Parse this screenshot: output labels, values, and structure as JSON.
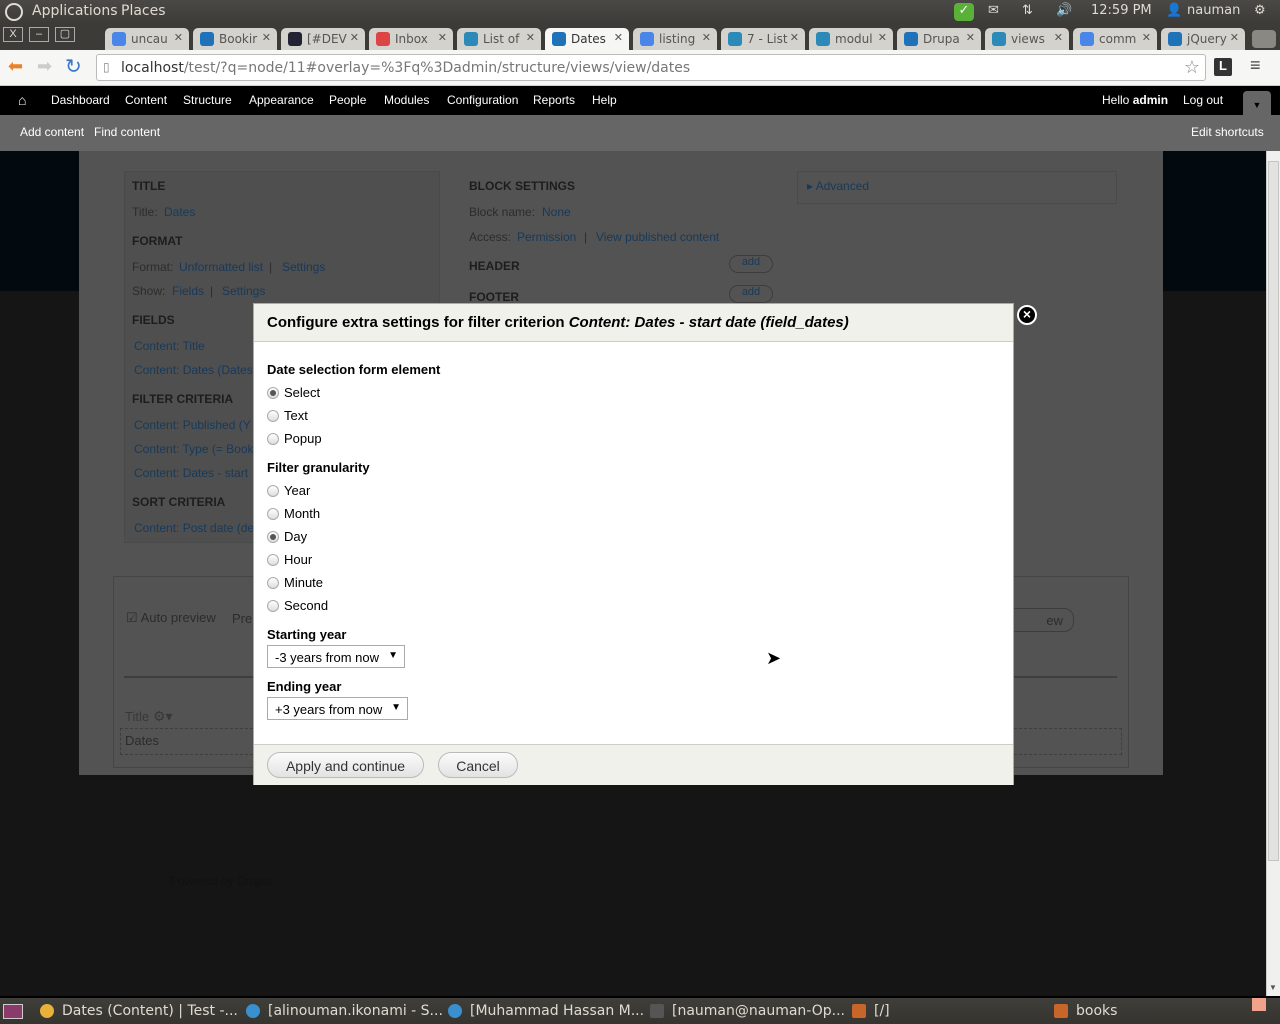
{
  "os_panel": {
    "menus": [
      "Applications",
      "Places"
    ],
    "time": "12:59 PM",
    "user": "nauman"
  },
  "browser": {
    "tabs": [
      {
        "label": "uncau",
        "icon": "google-icon",
        "active": false
      },
      {
        "label": "Bookir",
        "icon": "drupal-icon",
        "active": false
      },
      {
        "label": "[#DEV",
        "icon": "project-icon",
        "active": false
      },
      {
        "label": "Inbox",
        "icon": "gmail-icon",
        "active": false
      },
      {
        "label": "List of",
        "icon": "drop-icon",
        "active": false
      },
      {
        "label": "Dates",
        "icon": "drupal-icon",
        "active": true
      },
      {
        "label": "listing",
        "icon": "google-icon",
        "active": false
      },
      {
        "label": "7 - List",
        "icon": "drop-icon",
        "active": false
      },
      {
        "label": "modul",
        "icon": "drop-icon",
        "active": false
      },
      {
        "label": "Drupa",
        "icon": "drupal-icon",
        "active": false
      },
      {
        "label": "views",
        "icon": "drop-icon",
        "active": false
      },
      {
        "label": "comm",
        "icon": "google-icon",
        "active": false
      },
      {
        "label": "jQuery",
        "icon": "drupal-icon",
        "active": false
      }
    ],
    "url_host": "localhost",
    "url_path": "/test/?q=node/11#overlay=%3Fq%3Dadmin/structure/views/view/dates"
  },
  "drupal_toolbar": {
    "menu": [
      "Dashboard",
      "Content",
      "Structure",
      "Appearance",
      "People",
      "Modules",
      "Configuration",
      "Reports",
      "Help"
    ],
    "hello": "Hello",
    "user": "admin",
    "logout": "Log out",
    "shortcuts": [
      "Add content",
      "Find content"
    ],
    "edit_shortcuts": "Edit shortcuts"
  },
  "views_ui": {
    "title_head": "TITLE",
    "title_label": "Title:",
    "title_value": "Dates",
    "format_head": "FORMAT",
    "format_label": "Format:",
    "format_value": "Unformatted list",
    "format_settings": "Settings",
    "show_label": "Show:",
    "show_value": "Fields",
    "show_settings": "Settings",
    "fields_head": "FIELDS",
    "fields": [
      "Content: Title",
      "Content: Dates (Dates"
    ],
    "filter_head": "FILTER CRITERIA",
    "filters": [
      "Content: Published (Y",
      "Content: Type (= Book",
      "Content: Dates - start"
    ],
    "sort_head": "SORT CRITERIA",
    "sorts": [
      "Content: Post date (de"
    ],
    "block_head": "BLOCK SETTINGS",
    "block_name_label": "Block name:",
    "block_name_value": "None",
    "access_label": "Access:",
    "access_value": "Permission",
    "access_detail": "View published content",
    "header_head": "HEADER",
    "footer_head": "FOOTER",
    "add_label": "add",
    "advanced": "Advanced",
    "auto_preview": "Auto preview",
    "preview_partial": "Pre",
    "update_preview_partial": "ew",
    "preview_col": "Title",
    "preview_row": "Dates",
    "powered_by": "Powered by Drupal"
  },
  "modal": {
    "title_prefix": "Configure extra settings for filter criterion",
    "title_subject": "Content: Dates - start date (field_dates)",
    "date_element_label": "Date selection form element",
    "date_element_options": [
      {
        "label": "Select",
        "checked": true
      },
      {
        "label": "Text",
        "checked": false
      },
      {
        "label": "Popup",
        "checked": false
      }
    ],
    "granularity_label": "Filter granularity",
    "granularity_options": [
      {
        "label": "Year",
        "checked": false
      },
      {
        "label": "Month",
        "checked": false
      },
      {
        "label": "Day",
        "checked": true
      },
      {
        "label": "Hour",
        "checked": false
      },
      {
        "label": "Minute",
        "checked": false
      },
      {
        "label": "Second",
        "checked": false
      }
    ],
    "starting_year_label": "Starting year",
    "starting_year_value": "-3 years from now",
    "ending_year_label": "Ending year",
    "ending_year_value": "+3 years from now",
    "apply_button": "Apply and continue",
    "cancel_button": "Cancel"
  },
  "taskbar": {
    "items": [
      {
        "label": "Dates (Content) | Test -...",
        "icon": "chrome-icon"
      },
      {
        "label": "[alinouman.ikonami - S...",
        "icon": "skype-icon"
      },
      {
        "label": "[Muhammad Hassan M...",
        "icon": "skype-icon"
      },
      {
        "label": "[nauman@nauman-Op...",
        "icon": "terminal-icon"
      },
      {
        "label": "[/]",
        "icon": "folder-icon"
      },
      {
        "label": "books",
        "icon": "folder-icon"
      }
    ]
  }
}
